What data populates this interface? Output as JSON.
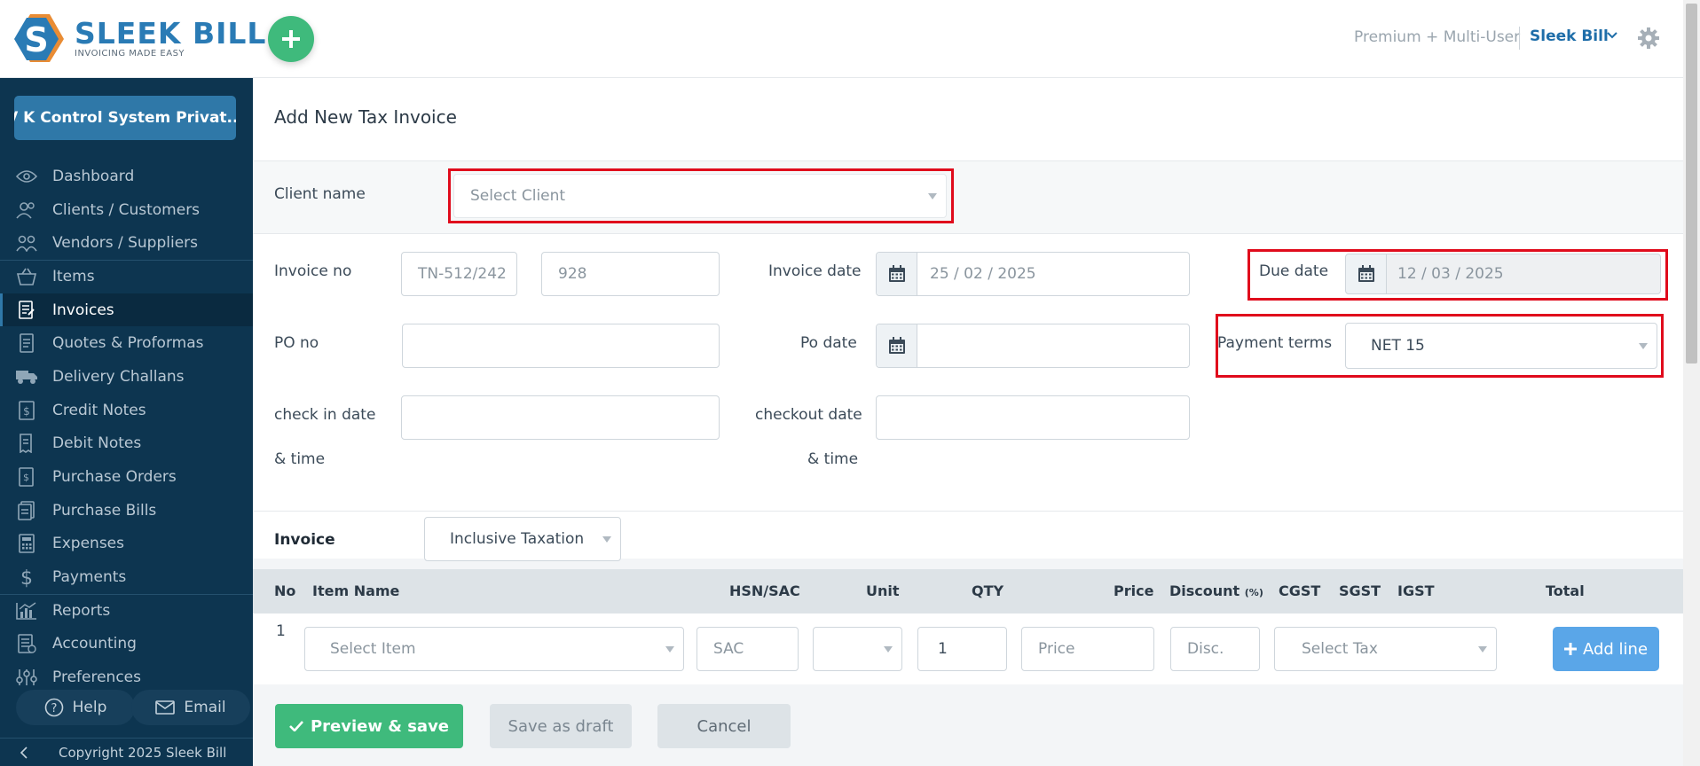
{
  "brand": {
    "name": "SLEEK BILL",
    "tagline": "INVOICING MADE EASY"
  },
  "header": {
    "plan": "Premium + Multi-User",
    "user": "Sleek Bill"
  },
  "sidebar": {
    "company": "V K Control System Privat...",
    "items": [
      {
        "label": "Dashboard",
        "icon": "eye-icon"
      },
      {
        "label": "Clients / Customers",
        "icon": "users-icon"
      },
      {
        "label": "Vendors / Suppliers",
        "icon": "vendors-icon"
      },
      {
        "label": "Items",
        "icon": "basket-icon"
      },
      {
        "label": "Invoices",
        "icon": "invoice-icon",
        "active": true
      },
      {
        "label": "Quotes & Proformas",
        "icon": "document-icon"
      },
      {
        "label": "Delivery Challans",
        "icon": "truck-icon"
      },
      {
        "label": "Credit Notes",
        "icon": "dollar-note-icon"
      },
      {
        "label": "Debit Notes",
        "icon": "receipt-icon"
      },
      {
        "label": "Purchase Orders",
        "icon": "purchase-order-icon"
      },
      {
        "label": "Purchase Bills",
        "icon": "bills-icon"
      },
      {
        "label": "Expenses",
        "icon": "calculator-icon"
      },
      {
        "label": "Payments",
        "icon": "dollar-icon"
      },
      {
        "label": "Reports",
        "icon": "chart-icon"
      },
      {
        "label": "Accounting",
        "icon": "ledger-icon"
      },
      {
        "label": "Preferences",
        "icon": "sliders-icon"
      }
    ],
    "help": "Help",
    "email": "Email",
    "copyright": "Copyright 2025 Sleek Bill"
  },
  "page": {
    "title": "Add New Tax Invoice"
  },
  "form": {
    "client_label": "Client name",
    "client_placeholder": "Select Client",
    "invoice_no_label": "Invoice no",
    "invoice_prefix": "TN-512/242",
    "invoice_number": "928",
    "invoice_date_label": "Invoice date",
    "invoice_date": "25 / 02 / 2025",
    "due_date_label": "Due date",
    "due_date": "12 / 03 / 2025",
    "po_no_label": "PO no",
    "po_date_label": "Po date",
    "payment_terms_label": "Payment terms",
    "payment_terms": "NET 15",
    "checkin_label": "check in date",
    "checkin_label2": "& time",
    "checkout_label": "checkout date",
    "checkout_label2": "& time"
  },
  "invoice": {
    "label": "Invoice",
    "taxation": "Inclusive Taxation",
    "columns": {
      "no": "No",
      "item": "Item Name",
      "hsn": "HSN/SAC",
      "unit": "Unit",
      "qty": "QTY",
      "price": "Price",
      "discount": "Discount",
      "discount_unit": "(%)",
      "cgst": "CGST",
      "sgst": "SGST",
      "igst": "IGST",
      "total": "Total"
    },
    "row": {
      "no": "1",
      "item_placeholder": "Select Item",
      "sac_placeholder": "SAC",
      "qty": "1",
      "price_placeholder": "Price",
      "disc_placeholder": "Disc.",
      "tax_placeholder": "Select Tax"
    },
    "add_line": "Add line"
  },
  "actions": {
    "preview": "Preview & save",
    "draft": "Save as draft",
    "cancel": "Cancel"
  },
  "colors": {
    "sidebar": "#0d3550",
    "accent_green": "#3fba7c",
    "brand_blue": "#2f78a8",
    "highlight_red": "#e00b1c"
  }
}
